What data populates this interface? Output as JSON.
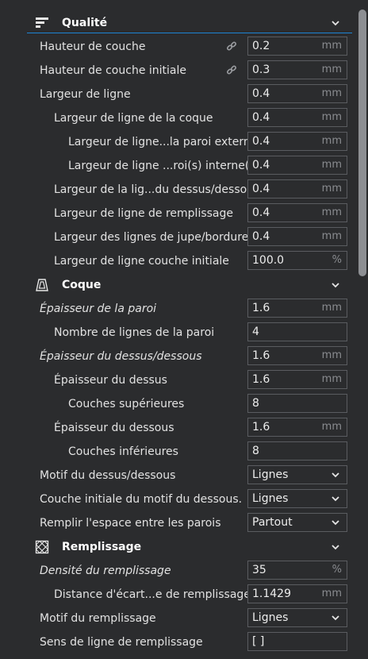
{
  "sections": {
    "qualite": {
      "title": "Qualité",
      "icon": "quality-icon"
    },
    "coque": {
      "title": "Coque",
      "icon": "shell-icon"
    },
    "remplissage": {
      "title": "Remplissage",
      "icon": "infill-icon"
    }
  },
  "rows": [
    {
      "label": "Hauteur de couche",
      "value": "0.2",
      "unit": "mm",
      "linked": true
    },
    {
      "label": "Hauteur de couche initiale",
      "value": "0.3",
      "unit": "mm",
      "linked": true
    },
    {
      "label": "Largeur de ligne",
      "value": "0.4",
      "unit": "mm"
    },
    {
      "label": "Largeur de ligne de la coque",
      "value": "0.4",
      "unit": "mm"
    },
    {
      "label": "Largeur de ligne...la paroi externe",
      "value": "0.4",
      "unit": "mm"
    },
    {
      "label": "Largeur de ligne ...roi(s) interne(s)",
      "value": "0.4",
      "unit": "mm"
    },
    {
      "label": "Largeur de la lig...du dessus/dessous",
      "value": "0.4",
      "unit": "mm"
    },
    {
      "label": "Largeur de ligne de remplissage",
      "value": "0.4",
      "unit": "mm"
    },
    {
      "label": "Largeur des lignes de jupe/bordure",
      "value": "0.4",
      "unit": "mm"
    },
    {
      "label": "Largeur de ligne couche initiale",
      "value": "100.0",
      "unit": "%"
    },
    {
      "label": "Épaisseur de la paroi",
      "value": "1.6",
      "unit": "mm"
    },
    {
      "label": "Nombre de lignes de la paroi",
      "value": "4",
      "unit": ""
    },
    {
      "label": "Épaisseur du dessus/dessous",
      "value": "1.6",
      "unit": "mm"
    },
    {
      "label": "Épaisseur du dessus",
      "value": "1.6",
      "unit": "mm"
    },
    {
      "label": "Couches supérieures",
      "value": "8",
      "unit": ""
    },
    {
      "label": "Épaisseur du dessous",
      "value": "1.6",
      "unit": "mm"
    },
    {
      "label": "Couches inférieures",
      "value": "8",
      "unit": ""
    },
    {
      "label": "Motif du dessus/dessous",
      "value": "Lignes",
      "unit": ""
    },
    {
      "label": "Couche initiale du motif du dessous.",
      "value": "Lignes",
      "unit": ""
    },
    {
      "label": "Remplir l'espace entre les parois",
      "value": "Partout",
      "unit": ""
    },
    {
      "label": "Densité du remplissage",
      "value": "35",
      "unit": "%"
    },
    {
      "label": "Distance d'écart...e de remplissage",
      "value": "1.1429",
      "unit": "mm"
    },
    {
      "label": "Motif du remplissage",
      "value": "Lignes",
      "unit": ""
    },
    {
      "label": "Sens de ligne de remplissage",
      "value": "[ ]",
      "unit": ""
    }
  ],
  "colors": {
    "accent": "#1c84d4",
    "background": "#2b2c2e",
    "field_border": "#5a5c60"
  }
}
